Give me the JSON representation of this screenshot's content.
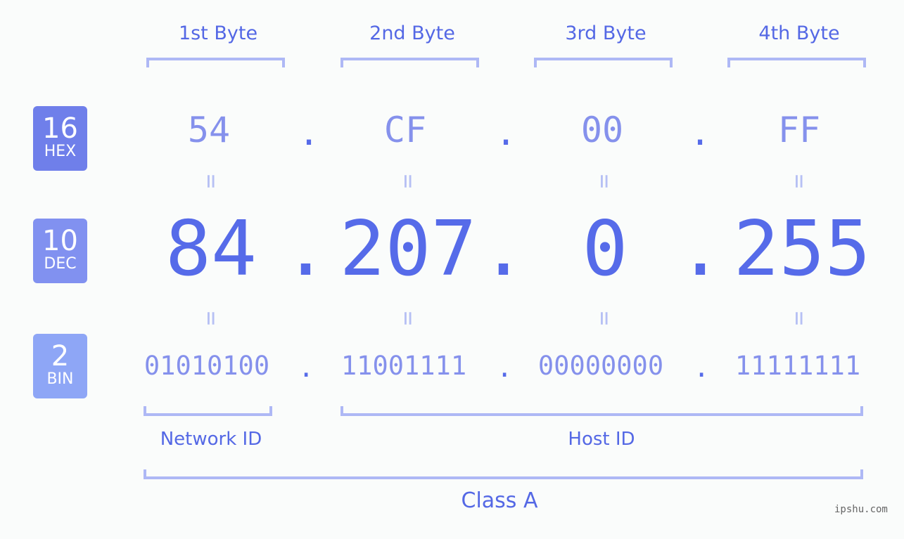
{
  "headers": [
    "1st Byte",
    "2nd Byte",
    "3rd Byte",
    "4th Byte"
  ],
  "badges": {
    "hex": {
      "base": "16",
      "label": "HEX",
      "color": "#6f7fea"
    },
    "dec": {
      "base": "10",
      "label": "DEC",
      "color": "#8191f0"
    },
    "bin": {
      "base": "2",
      "label": "BIN",
      "color": "#8ea6f6"
    }
  },
  "ip": {
    "hex": [
      "54",
      "CF",
      "00",
      "FF"
    ],
    "dec": [
      "84",
      "207",
      "0",
      "255"
    ],
    "bin": [
      "01010100",
      "11001111",
      "00000000",
      "11111111"
    ],
    "separator": ".",
    "equals": "="
  },
  "segments": {
    "network": "Network ID",
    "host": "Host ID",
    "class": "Class A"
  },
  "watermark": "ipshu.com"
}
